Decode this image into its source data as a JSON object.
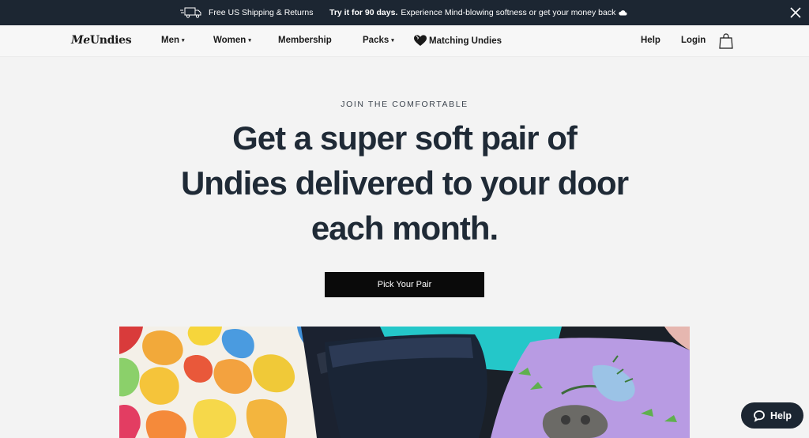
{
  "announcement": {
    "shipping": "Free US Shipping & Returns",
    "trial_bold": "Try it for 90 days.",
    "trial_text": "Experience Mind-blowing softness or get your money back",
    "trial_icon": "cloud-icon"
  },
  "nav": {
    "logo_me": "Me",
    "logo_undies": "Undies",
    "items": [
      {
        "label": "Men",
        "has_dropdown": true
      },
      {
        "label": "Women",
        "has_dropdown": true
      },
      {
        "label": "Membership",
        "has_dropdown": false
      },
      {
        "label": "Packs",
        "has_dropdown": true
      },
      {
        "label": "Matching Undies",
        "has_dropdown": false
      }
    ],
    "help": "Help",
    "login": "Login",
    "caret": "▾"
  },
  "hero": {
    "eyebrow": "JOIN THE COMFORTABLE",
    "title_line1": "Get a super soft pair of",
    "title_line2": "Undies delivered to your door",
    "title_line3": "each month.",
    "cta": "Pick Your Pair"
  },
  "chat": {
    "label": "Help"
  },
  "colors": {
    "topbar": "#1c2632",
    "text": "#1f2a36",
    "cta": "#0a0a0a",
    "background": "#f3f3f3"
  }
}
